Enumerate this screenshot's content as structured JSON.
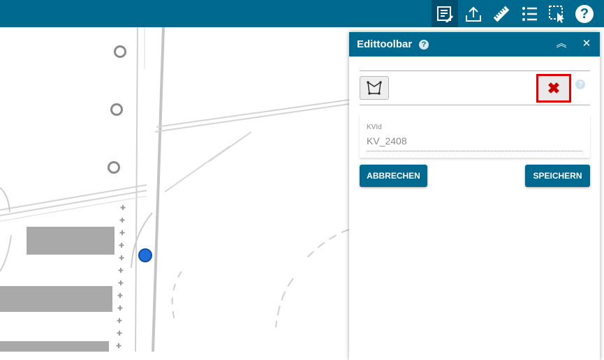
{
  "toolbar": {
    "icons": [
      "edit-form-icon",
      "upload-icon",
      "ruler-icon",
      "list-icon",
      "select-area-icon",
      "help-icon"
    ],
    "help_glyph": "?"
  },
  "panel": {
    "title": "Edittoolbar",
    "help_glyph": "?",
    "collapse_glyph": "︽",
    "close_glyph": "✕",
    "draw_tool_icon": "polygon-draw-icon",
    "delete_glyph": "✖",
    "field": {
      "label": "KVId",
      "value": "KV_2408"
    },
    "cancel_label": "ABBRECHEN",
    "save_label": "SPEICHERN"
  },
  "colors": {
    "brand": "#00698f",
    "delete_highlight": "#e00000",
    "location_marker": "#1f6fd6"
  }
}
